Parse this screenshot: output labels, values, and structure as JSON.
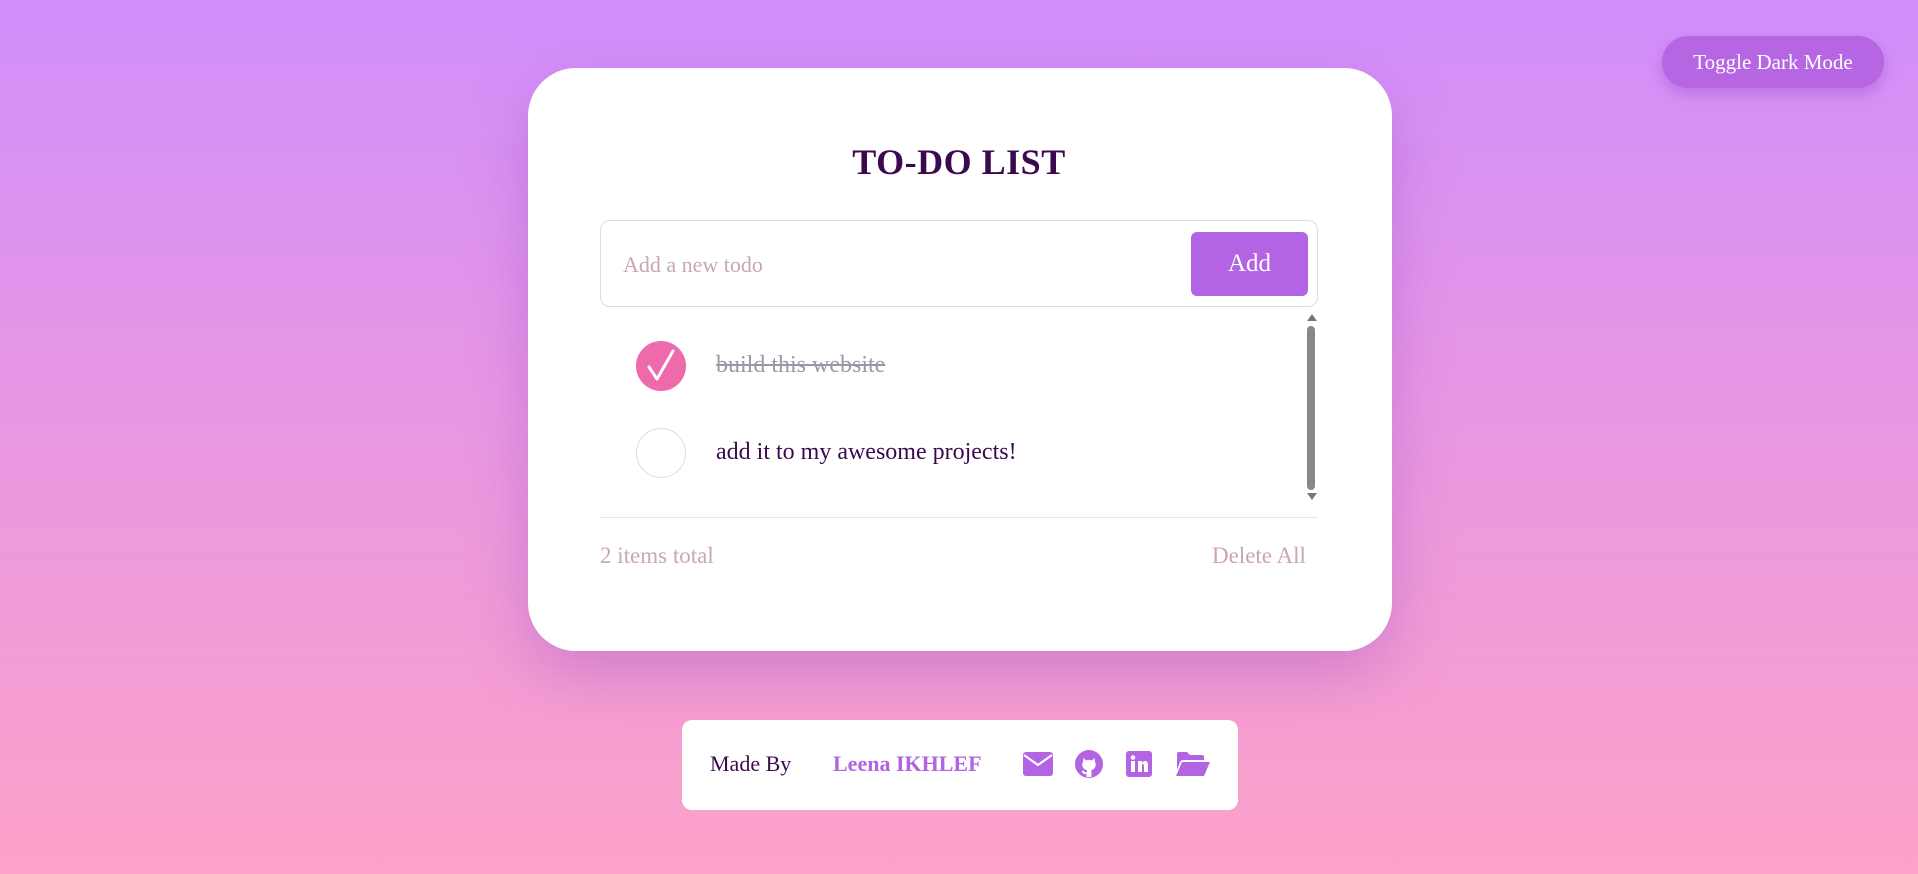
{
  "header": {
    "toggle_label": "Toggle Dark Mode"
  },
  "card": {
    "title": "TO-DO LIST",
    "input": {
      "placeholder": "Add a new todo",
      "value": ""
    },
    "add_label": "Add",
    "todos": [
      {
        "text": "build this website",
        "completed": true
      },
      {
        "text": "add it to my awesome projects!",
        "completed": false
      }
    ],
    "items_total": "2 items total",
    "delete_all_label": "Delete All"
  },
  "footer": {
    "made_by": "Made By",
    "author": "Leena IKHLEF",
    "icons": [
      "envelope-icon",
      "github-icon",
      "linkedin-icon",
      "folder-open-icon"
    ]
  },
  "colors": {
    "accent": "#b264e2",
    "check_done": "#ee6aaa",
    "title": "#3b0a4e",
    "muted": "#c9a6b4",
    "background_top": "#d08efb",
    "background_bottom": "#fda1c8"
  }
}
